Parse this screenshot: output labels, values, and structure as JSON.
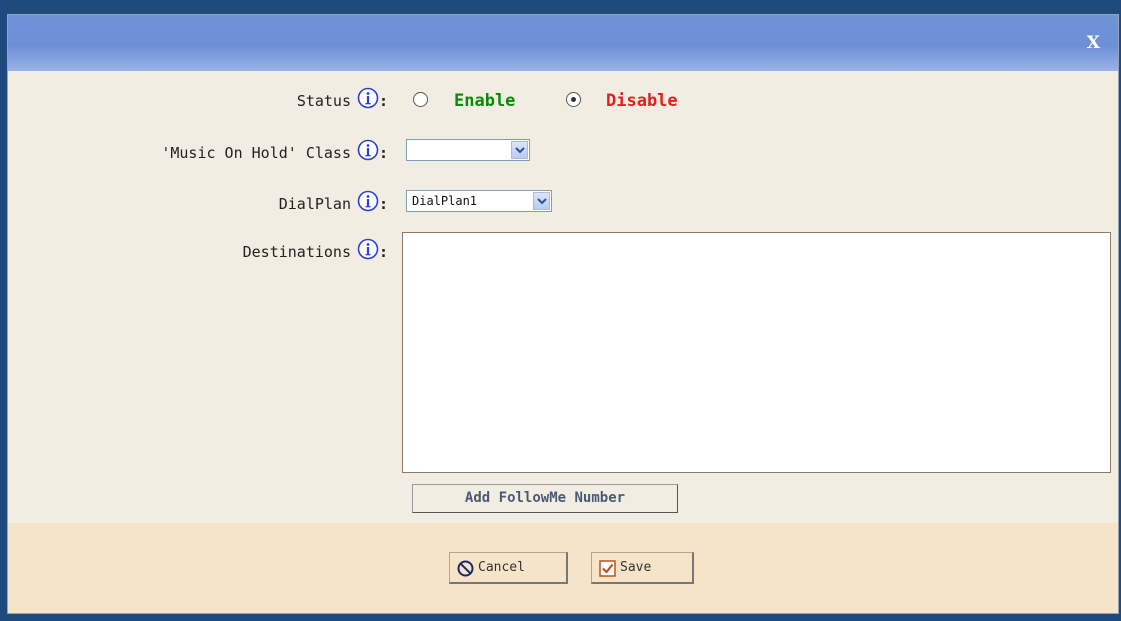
{
  "dialog": {
    "close_label": "X"
  },
  "form": {
    "status": {
      "label": "Status",
      "options": [
        "Enable",
        "Disable"
      ],
      "selected": "Disable",
      "enable_color": "#0a8a0a",
      "disable_color": "#e02020"
    },
    "moh_class": {
      "label": "'Music On Hold' Class",
      "value": ""
    },
    "dialplan": {
      "label": "DialPlan",
      "value": "DialPlan1"
    },
    "destinations": {
      "label": "Destinations",
      "value": ""
    },
    "colon": ":",
    "info_icon": "info-icon",
    "add_button_label": "Add FollowMe Number"
  },
  "footer": {
    "cancel_label": "Cancel",
    "save_label": "Save"
  },
  "colors": {
    "titlebar": "#6f92da",
    "body_bg": "#f2ede3",
    "footer_bg": "#f5e4c8",
    "info_icon": "#2a3fd8"
  }
}
